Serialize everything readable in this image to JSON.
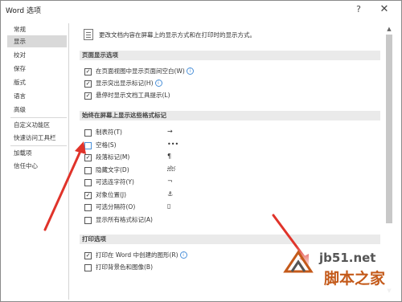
{
  "window": {
    "title": "Word 选项",
    "help_glyph": "?",
    "close_glyph": "✕"
  },
  "sidebar": {
    "items": [
      {
        "label": "常规"
      },
      {
        "label": "显示",
        "active": true
      },
      {
        "label": "校对"
      },
      {
        "label": "保存"
      },
      {
        "label": "版式"
      },
      {
        "label": "语言"
      },
      {
        "label": "高级"
      },
      {
        "label": "自定义功能区"
      },
      {
        "label": "快速访问工具栏"
      },
      {
        "label": "加载项"
      },
      {
        "label": "信任中心"
      }
    ]
  },
  "main": {
    "intro": "更改文档内容在屏幕上的显示方式和在打印时的显示方式。",
    "page_display": {
      "header": "页面显示选项",
      "options": [
        {
          "label": "在页面视图中显示页面间空白(W)",
          "checked": true,
          "info": "i"
        },
        {
          "label": "显示突出显示标记(H)",
          "checked": true,
          "info": "i"
        },
        {
          "label": "悬停时显示文档工具提示(L)",
          "checked": true
        }
      ]
    },
    "formatting_marks": {
      "header": "始终在屏幕上显示这些格式标记",
      "options": [
        {
          "label": "制表符(T)",
          "checked": false,
          "symbol": "→"
        },
        {
          "label": "空格(S)",
          "checked": false,
          "symbol": "•••"
        },
        {
          "label": "段落标记(M)",
          "checked": true,
          "symbol": "¶"
        },
        {
          "label": "隐藏文字(D)",
          "checked": false,
          "symbol": "abc"
        },
        {
          "label": "可选连字符(Y)",
          "checked": false,
          "symbol": "¬"
        },
        {
          "label": "对象位置(J)",
          "checked": true,
          "symbol": "⚓"
        },
        {
          "label": "可选分隔符(O)",
          "checked": false,
          "symbol": "▯"
        },
        {
          "label": "显示所有格式标记(A)",
          "checked": false
        }
      ]
    },
    "print": {
      "header": "打印选项",
      "options": [
        {
          "label": "打印在 Word 中创建的图形(R)",
          "checked": true,
          "info": "i"
        },
        {
          "label": "打印背景色和图像(B)",
          "checked": false
        }
      ]
    }
  },
  "scrollbar": {
    "up_glyph": "▲",
    "down_glyph": "▼",
    "position": 0.0
  },
  "watermark": {
    "url": "jb51.net",
    "name": "脚本之家"
  },
  "annotation_color": "#e0332a",
  "checkmark": "✓"
}
